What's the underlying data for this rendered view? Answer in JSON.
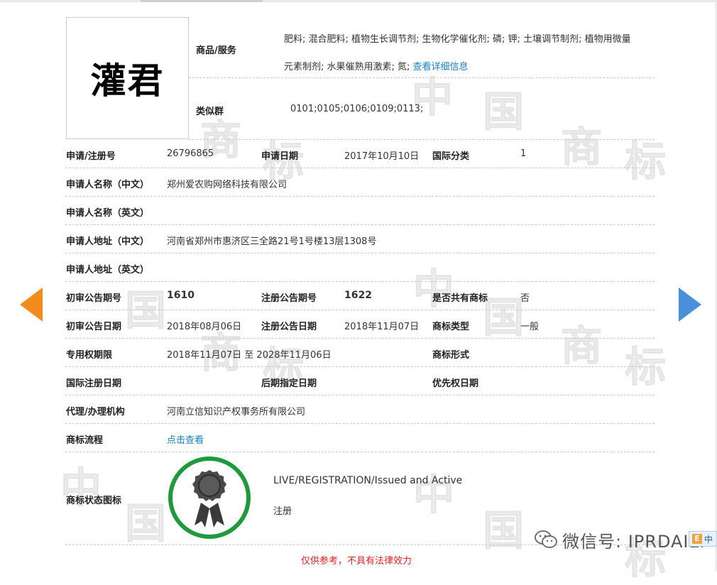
{
  "mark": {
    "name": "灌君"
  },
  "goods": {
    "label": "商品/服务",
    "line1": "肥料; 混合肥料; 植物生长调节剂; 生物化学催化剂; 磷; 钾; 土壤调节制剂; 植物用微量",
    "line2": "元素制剂; 水果催熟用激素; 氮;",
    "detail_link": "查看详细信息"
  },
  "similar_group": {
    "label": "类似群",
    "value": "0101;0105;0106;0109;0113;"
  },
  "fields": {
    "reg_no_label": "申请/注册号",
    "reg_no": "26796865",
    "app_date_label": "申请日期",
    "app_date": "2017年10月10日",
    "intl_class_label": "国际分类",
    "intl_class": "1",
    "applicant_cn_label": "申请人名称（中文）",
    "applicant_cn": "郑州爱农购网络科技有限公司",
    "applicant_en_label": "申请人名称（英文）",
    "applicant_en": "",
    "address_cn_label": "申请人地址（中文）",
    "address_cn": "河南省郑州市惠济区三全路21号1号楼13层1308号",
    "address_en_label": "申请人地址（英文）",
    "address_en": "",
    "prelim_issue_label": "初审公告期号",
    "prelim_issue": "1610",
    "reg_issue_label": "注册公告期号",
    "reg_issue": "1622",
    "shared_label": "是否共有商标",
    "shared": "否",
    "prelim_date_label": "初审公告日期",
    "prelim_date": "2018年08月06日",
    "reg_date_label": "注册公告日期",
    "reg_date": "2018年11月07日",
    "mark_type_label": "商标类型",
    "mark_type": "一般",
    "term_label": "专用权期限",
    "term": "2018年11月07日 至 2028年11月06日",
    "mark_form_label": "商标形式",
    "mark_form": "",
    "intl_reg_date_label": "国际注册日期",
    "intl_reg_date": "",
    "later_designation_label": "后期指定日期",
    "later_designation": "",
    "priority_date_label": "优先权日期",
    "priority_date": "",
    "agent_label": "代理/办理机构",
    "agent": "河南立信知识产权事务所有限公司",
    "process_label": "商标流程",
    "process_link": "点击查看",
    "status_label": "商标状态图标",
    "status_en": "LIVE/REGISTRATION/Issued and Active",
    "status_cn": "注册"
  },
  "disclaimer": "仅供参考，不具有法律效力",
  "wechat": {
    "text": "微信号: IPRDAILY",
    "badge": "中"
  },
  "watermark": {
    "chars": [
      "商",
      "标",
      "中",
      "国"
    ]
  },
  "colors": {
    "link": "#1a7fc1",
    "prev_arrow": "#f28c1c",
    "next_arrow": "#4a90d9",
    "status_ring": "#1e9a3c",
    "disclaimer": "#e02020"
  }
}
